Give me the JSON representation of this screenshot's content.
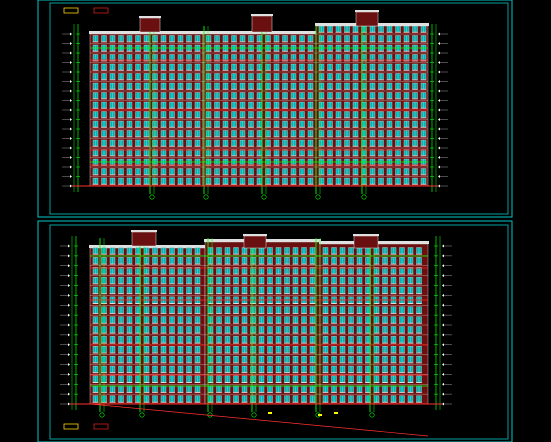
{
  "drawing": {
    "background": "#000000",
    "frame_color": "#00c8c8",
    "palette": {
      "facade": "#6b1010",
      "window": "#00b4b4",
      "window_frame": "#e8e8e8",
      "balcony": "#ffffff",
      "structure_line": "#00ff00",
      "dimension_line": "#00ff00",
      "floor_band": "#ff2020",
      "roof": "#e0e0e0",
      "ground": "#ff3030",
      "marker": "#ffff00",
      "legend_yellow": "#ffd400",
      "legend_red": "#d02020"
    },
    "sheets": [
      {
        "id": "upper",
        "caption": "",
        "scale_note": "",
        "floors": 16,
        "icons": [
          "grid-axis-bubble-icon",
          "elevation-mark-icon"
        ]
      },
      {
        "id": "lower",
        "caption": "",
        "scale_note": "",
        "floors": 16,
        "icons": [
          "grid-axis-bubble-icon",
          "elevation-mark-icon"
        ]
      }
    ]
  }
}
